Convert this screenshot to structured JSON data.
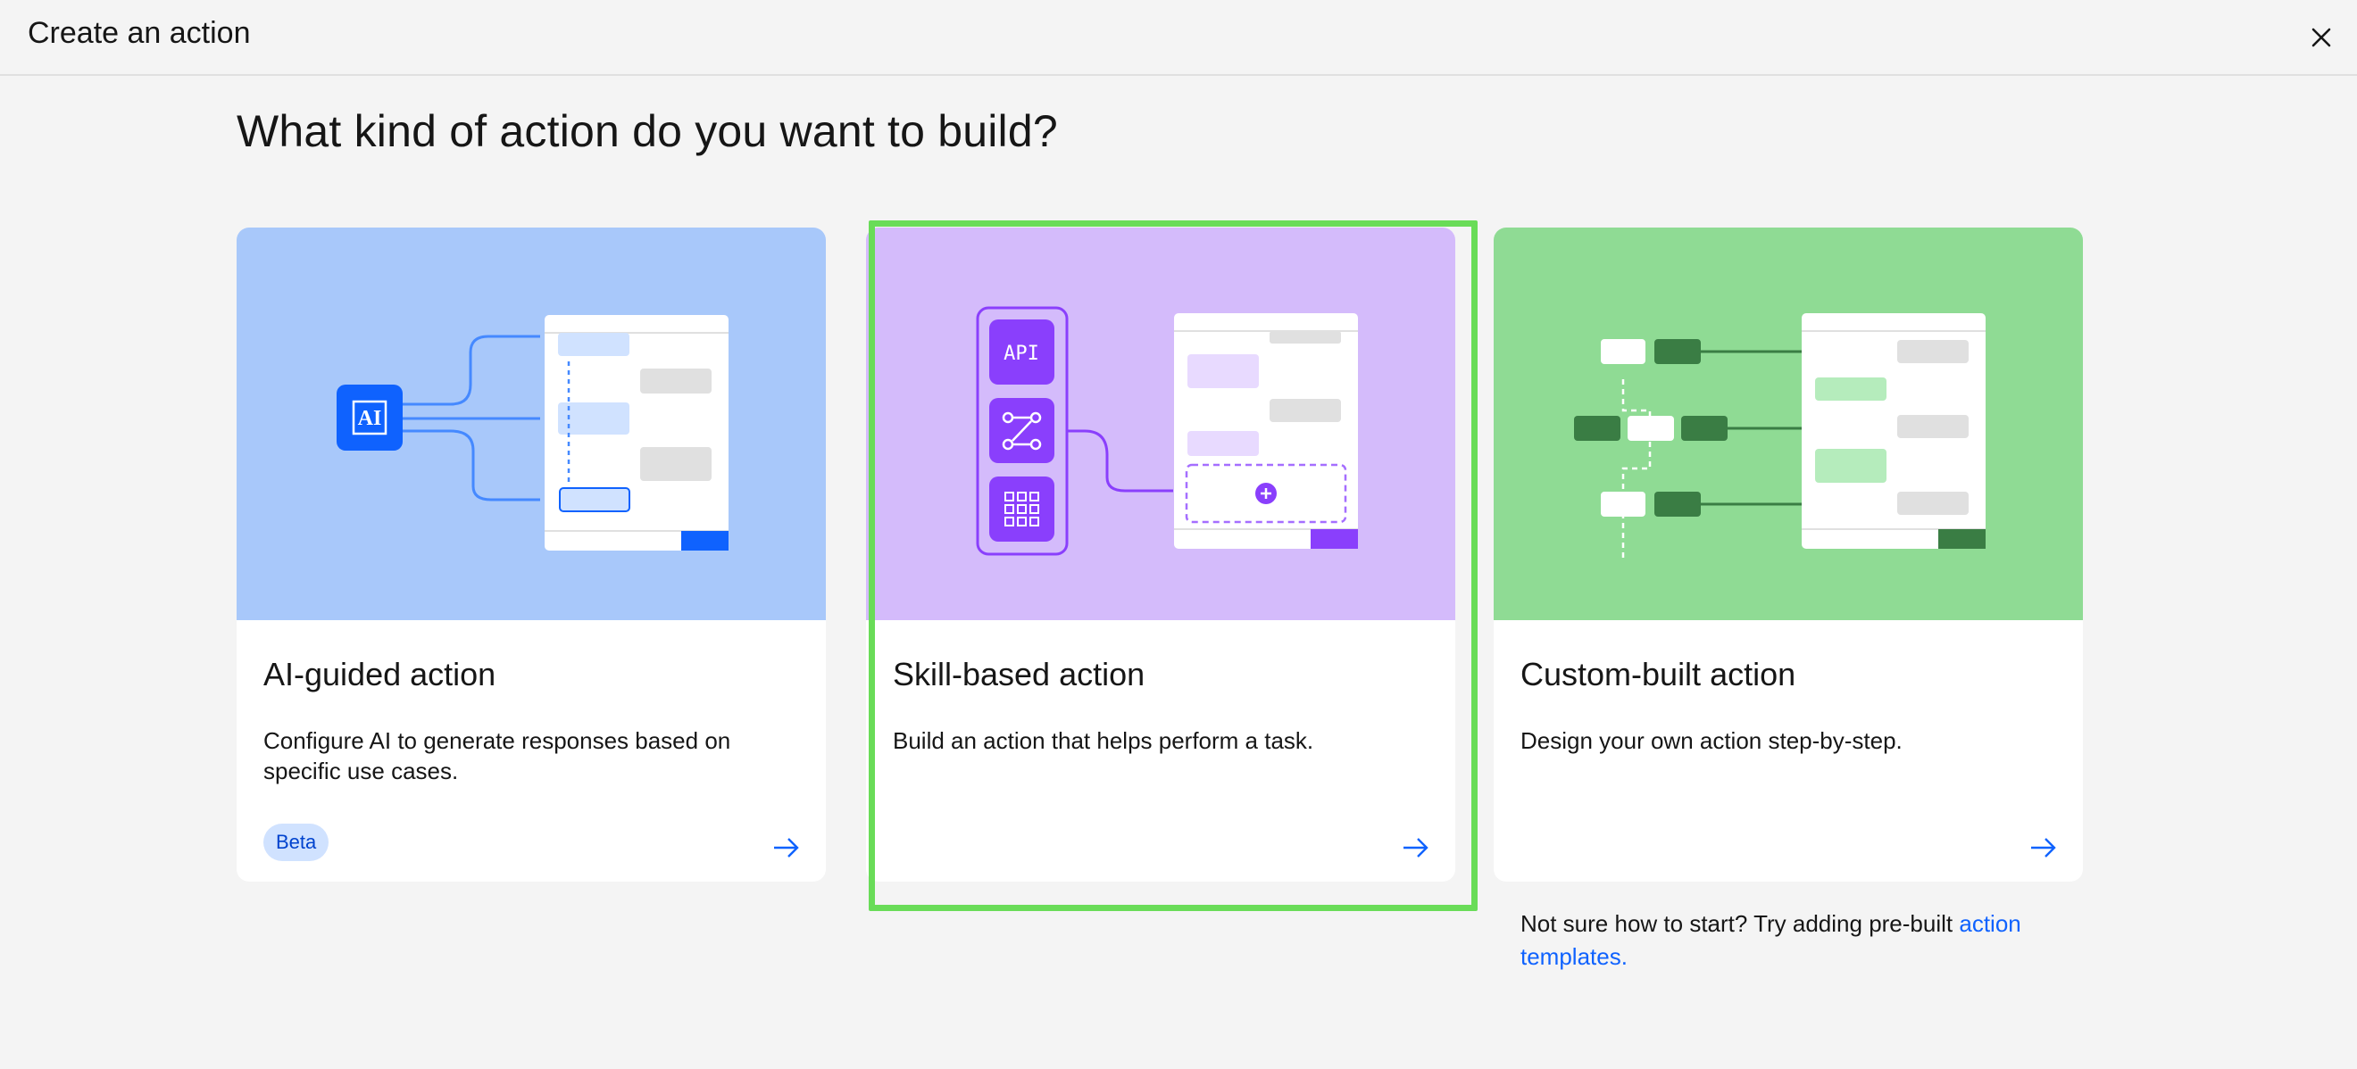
{
  "header": {
    "title": "Create an action"
  },
  "main": {
    "heading": "What kind of action do you want to build?",
    "cards": [
      {
        "title": "AI-guided action",
        "description": "Configure AI to generate responses based on specific use cases.",
        "badge": "Beta",
        "illustration_color": "#a8c8fa",
        "accent_color": "#0f62fe",
        "icon_label": "AI"
      },
      {
        "title": "Skill-based action",
        "description": "Build an action that helps perform a task.",
        "illustration_color": "#d4bbfb",
        "accent_color": "#8a3ffc",
        "icon_label": "API",
        "selected": true
      },
      {
        "title": "Custom-built action",
        "description": "Design your own action step-by-step.",
        "illustration_color": "#8fdb94",
        "accent_color": "#3a7d44"
      }
    ],
    "footnote": {
      "text": "Not sure how to start? Try adding pre-built",
      "link": "action templates."
    }
  },
  "colors": {
    "background": "#f4f4f4",
    "selection_outline": "#69dc58",
    "link": "#0f62fe"
  }
}
